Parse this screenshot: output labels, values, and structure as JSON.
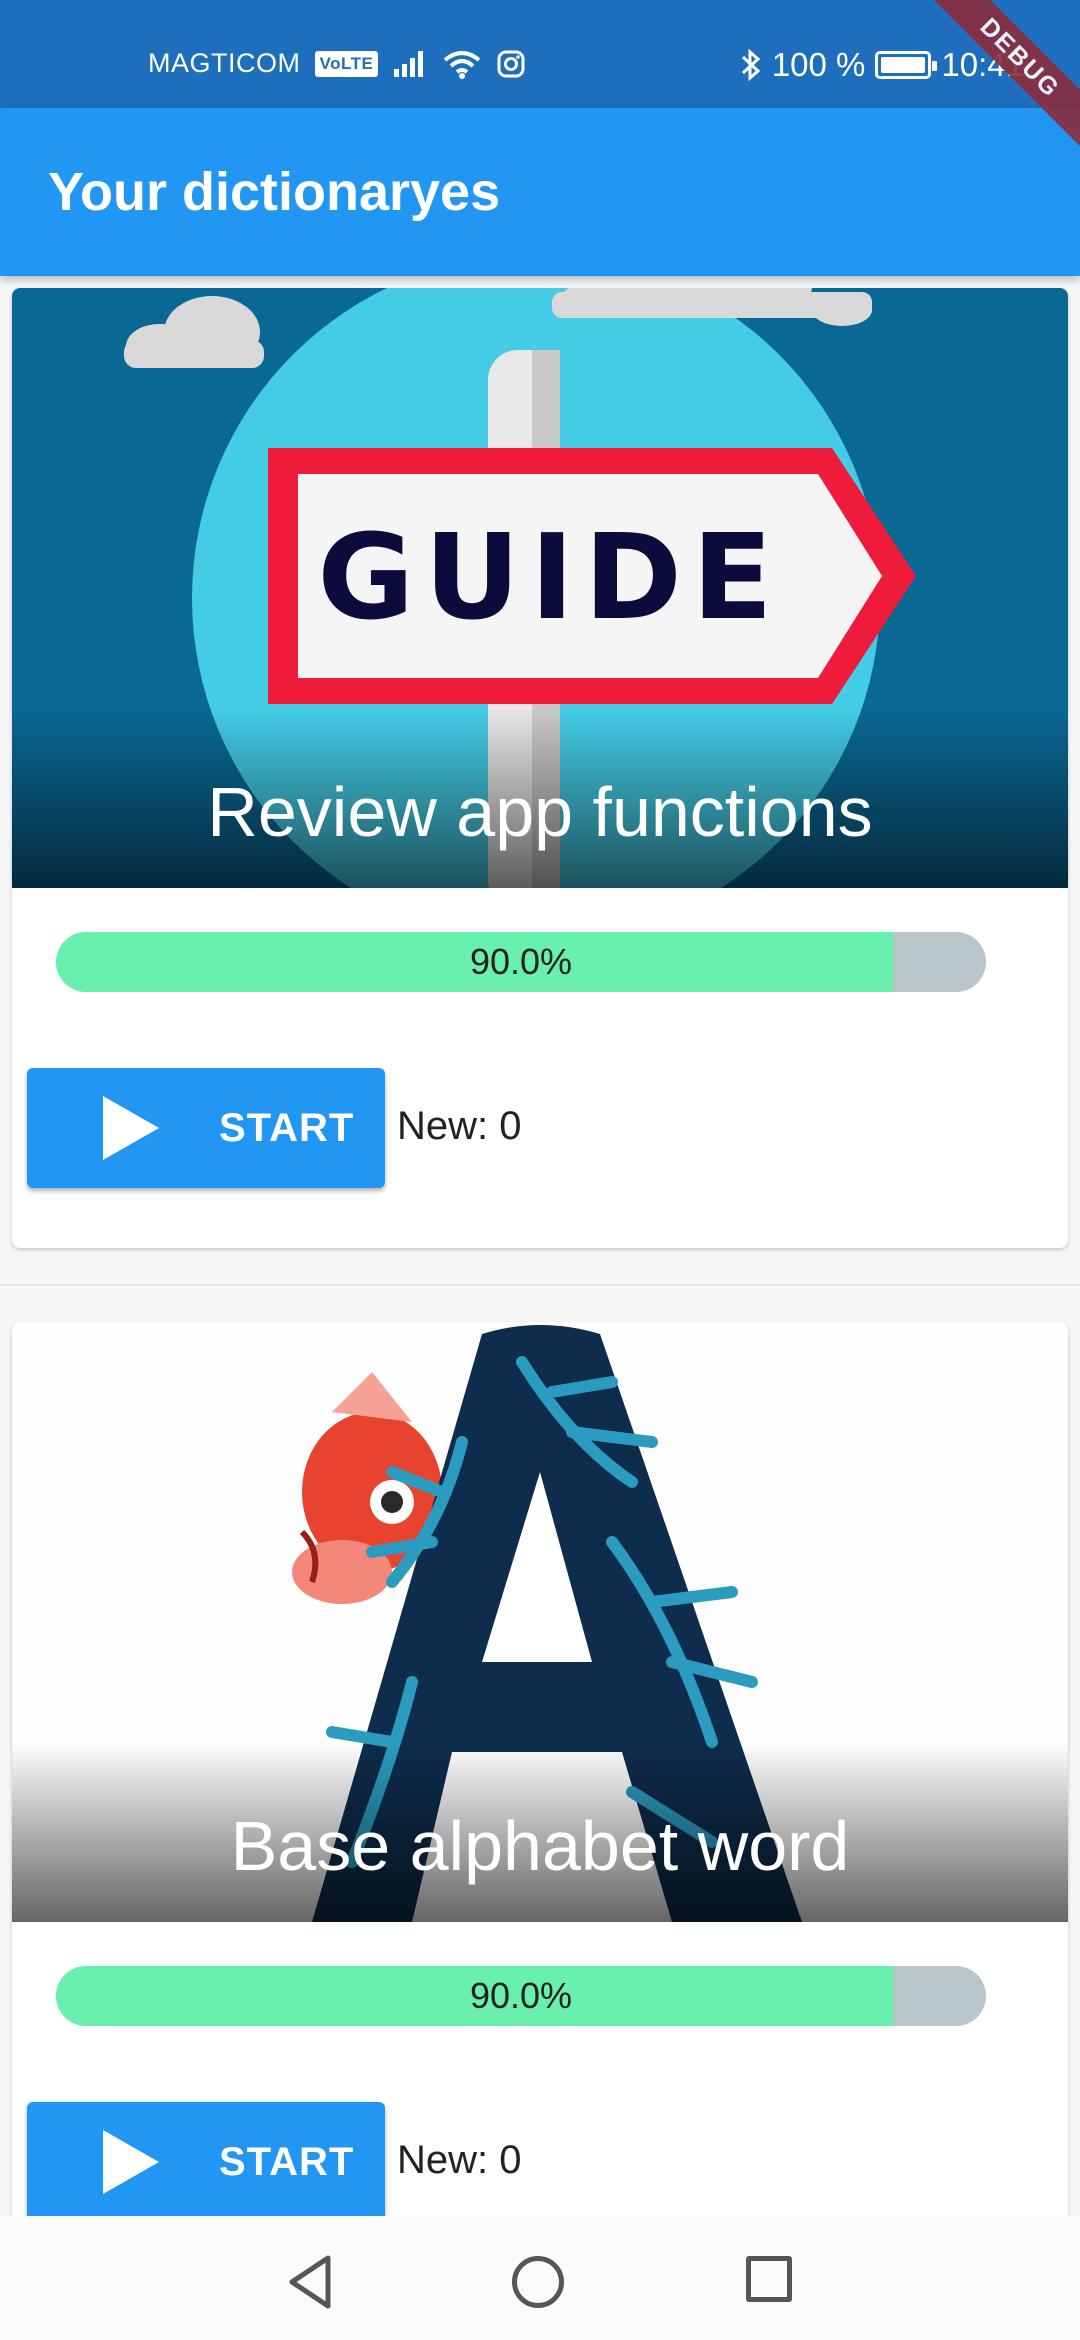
{
  "status_bar": {
    "carrier": "MAGTICOM",
    "volte": "VoLTE",
    "bluetooth_icon": "bluetooth-icon",
    "battery": "100 %",
    "time": "10:41"
  },
  "debug_banner": "DEBUG",
  "app_bar": {
    "title": "Your dictionaryes"
  },
  "cards": [
    {
      "title": "Review app functions",
      "cover_text": "GUIDE",
      "progress": {
        "value": 0.9,
        "label": "90.0%"
      },
      "start_label": "START",
      "new_label": "New: 0"
    },
    {
      "title": "Base alphabet word",
      "progress": {
        "value": 0.9,
        "label": "90.0%"
      },
      "start_label": "START",
      "new_label": "New: 0"
    }
  ],
  "colors": {
    "status_bar": "#1d6fbd",
    "app_bar": "#2196f3",
    "progress_fill": "#69f0ae",
    "progress_track": "#b8c6cc",
    "button": "#2196f3"
  },
  "nav_bar": {
    "icons": [
      "back-icon",
      "home-icon",
      "recent-apps-icon"
    ]
  }
}
